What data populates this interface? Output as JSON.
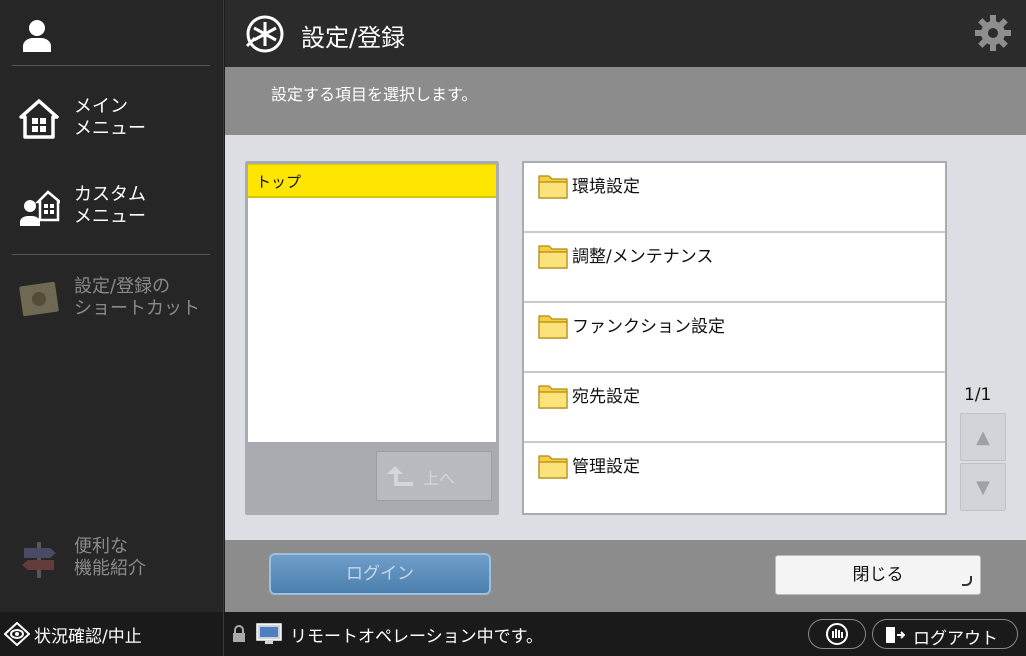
{
  "header": {
    "title": "設定/登録"
  },
  "instruction": "設定する項目を選択します。",
  "sidebar": {
    "items": [
      {
        "label": "メイン\nメニュー"
      },
      {
        "label": "カスタム\nメニュー"
      },
      {
        "label": "設定/登録の\nショートカット"
      },
      {
        "label": "便利な\n機能紹介"
      }
    ]
  },
  "tree": {
    "current": "トップ",
    "up_label": "上へ"
  },
  "items": [
    {
      "label": "環境設定"
    },
    {
      "label": "調整/メンテナンス"
    },
    {
      "label": "ファンクション設定"
    },
    {
      "label": "宛先設定"
    },
    {
      "label": "管理設定"
    }
  ],
  "pager": {
    "page": "1/1"
  },
  "actions": {
    "login_label": "ログイン",
    "close_label": "閉じる"
  },
  "statusbar": {
    "status_label": "状況確認/中止",
    "message": "リモートオペレーション中です。",
    "logout_label": "ログアウト"
  }
}
